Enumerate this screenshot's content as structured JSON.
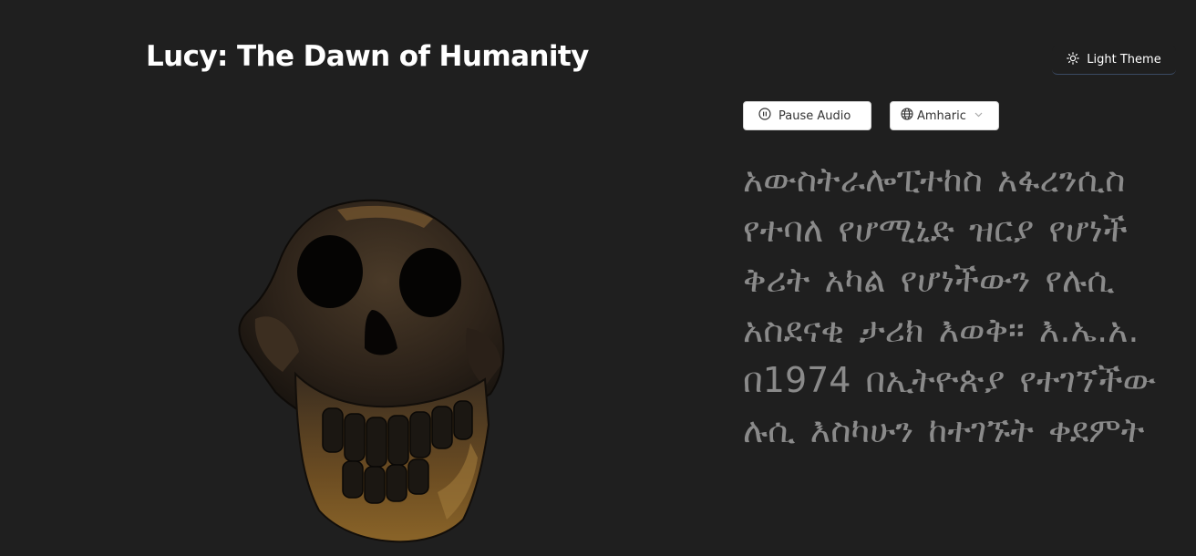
{
  "header": {
    "title": "Lucy: The Dawn of Humanity",
    "theme_button_label": "Light Theme"
  },
  "controls": {
    "audio_button_label": "Pause Audio",
    "language_selected": "Amharic"
  },
  "narration": {
    "text": "አውስትራሎፒተከስ አፋረንሲስ የተባለ የሆሚኒድ ዝርያ የሆነች ቅሪት አካል የሆነችውን የሉሲ አስደናቂ ታሪክ እወቅ። እ.ኤ.አ. በ1974 በኢትዮጵያ የተገኘችው ሉሲ እስካሁን ከተገኙት ቀደምት"
  },
  "icons": {
    "theme": "sun-icon",
    "audio": "pause-circle-icon",
    "language": "globe-icon",
    "dropdown": "chevron-down-icon"
  },
  "colors": {
    "background": "#1f1f1f",
    "title": "#ffffff",
    "narration_text": "#8a8a8a",
    "button_background": "#ffffff"
  }
}
